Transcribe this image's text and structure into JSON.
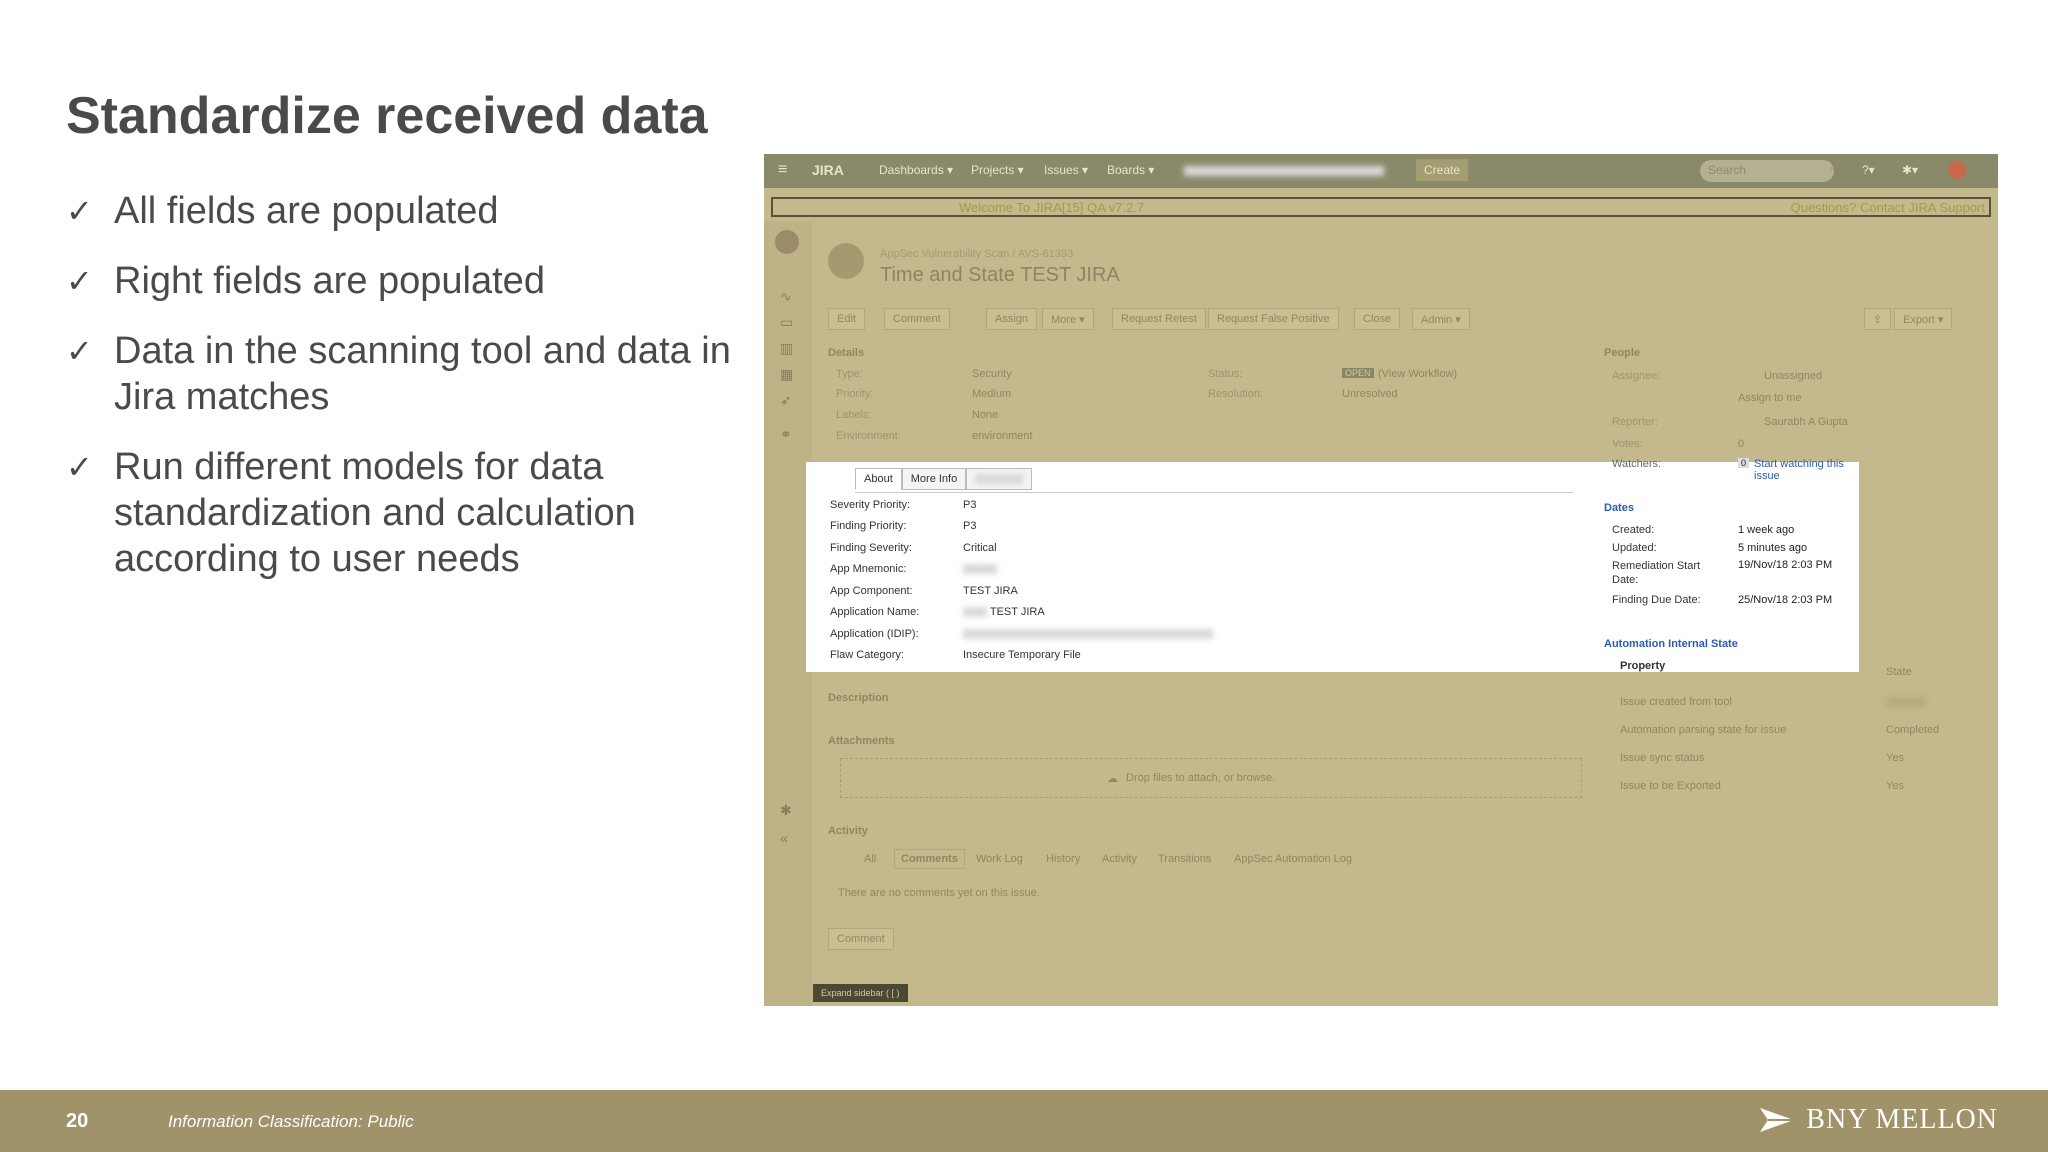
{
  "slide": {
    "title": "Standardize received data",
    "bullets": [
      "All fields are populated",
      "Right fields are populated",
      "Data in the scanning tool and data in Jira matches",
      "Run different models for data standardization and calculation according to user needs"
    ],
    "check_glyph": "✓",
    "page_number": "20",
    "classification": "Information Classification: Public",
    "logo_text": "BNY MELLON"
  },
  "jira": {
    "nav": {
      "logo": "JIRA",
      "menus": [
        "Dashboards ▾",
        "Projects ▾",
        "Issues ▾",
        "Boards ▾"
      ],
      "create": "Create",
      "search_placeholder": "Search"
    },
    "banner": {
      "welcome": "Welcome To JIRA[15] QA v7.2.7",
      "support": "Questions? Contact JIRA Support"
    },
    "breadcrumb": "AppSec Vulnerability Scan / AVS-61393",
    "issue_title": "Time and State TEST JIRA",
    "actions": [
      "Edit",
      "Comment",
      "Assign",
      "More ▾",
      "Request Retest",
      "Request False Positive",
      "Close",
      "Admin ▾"
    ],
    "export": "Export ▾",
    "details": {
      "heading": "Details",
      "type_label": "Type:",
      "type_value": "Security",
      "priority_label": "Priority:",
      "priority_value": "Medium",
      "labels_label": "Labels:",
      "labels_value": "None",
      "environment_label": "Environment:",
      "environment_value": "environment",
      "status_label": "Status:",
      "status_badge": "OPEN",
      "status_workflow": "(View Workflow)",
      "resolution_label": "Resolution:",
      "resolution_value": "Unresolved"
    },
    "people": {
      "heading": "People",
      "assignee_label": "Assignee:",
      "assignee_value": "Unassigned",
      "assign_to_me": "Assign to me",
      "reporter_label": "Reporter:",
      "reporter_value": "Saurabh A Gupta",
      "votes_label": "Votes:",
      "votes_value": "0",
      "watchers_label": "Watchers:",
      "watchers_count": "0",
      "watchers_link": "Start watching this issue"
    },
    "about": {
      "tabs": [
        "About",
        "More Info"
      ],
      "rows": [
        {
          "k": "Severity Priority:",
          "v": "P3"
        },
        {
          "k": "Finding Priority:",
          "v": "P3"
        },
        {
          "k": "Finding Severity:",
          "v": "Critical"
        },
        {
          "k": "App Mnemonic:",
          "v": ""
        },
        {
          "k": "App Component:",
          "v": "TEST JIRA"
        },
        {
          "k": "Application Name:",
          "v": "TEST JIRA"
        },
        {
          "k": "Application (IDIP):",
          "v": ""
        },
        {
          "k": "Flaw Category:",
          "v": "Insecure Temporary File"
        }
      ]
    },
    "dates": {
      "heading": "Dates",
      "created_label": "Created:",
      "created_value": "1 week ago",
      "updated_label": "Updated:",
      "updated_value": "5 minutes ago",
      "remediation_label": "Remediation Start Date:",
      "remediation_value": "19/Nov/18 2:03 PM",
      "due_label": "Finding Due Date:",
      "due_value": "25/Nov/18 2:03 PM"
    },
    "automation": {
      "heading": "Automation Internal State",
      "col_property": "Property",
      "col_state": "State",
      "rows": [
        {
          "p": "Issue created from tool",
          "s": ""
        },
        {
          "p": "Automation parsing state for issue",
          "s": "Completed"
        },
        {
          "p": "Issue sync status",
          "s": "Yes"
        },
        {
          "p": "Issue to be Exported",
          "s": "Yes"
        }
      ]
    },
    "description_heading": "Description",
    "attachments_heading": "Attachments",
    "drop_text": "Drop files to attach, or browse.",
    "activity": {
      "heading": "Activity",
      "tabs": [
        "All",
        "Comments",
        "Work Log",
        "History",
        "Activity",
        "Transitions",
        "AppSec Automation Log"
      ],
      "empty": "There are no comments yet on this issue."
    },
    "comment_button": "Comment",
    "expand_sidebar": "Expand sidebar ( [ )"
  }
}
